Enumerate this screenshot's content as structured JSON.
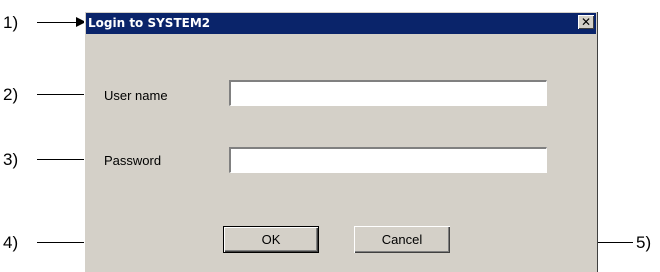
{
  "callouts": {
    "c1": "1)",
    "c2": "2)",
    "c3": "3)",
    "c4": "4)",
    "c5": "5)"
  },
  "dialog": {
    "title": "Login to SYSTEM2",
    "close_icon": "close-icon",
    "close_glyph": "✕",
    "username_label": "User name",
    "username_value": "",
    "password_label": "Password",
    "password_value": "",
    "ok_label": "OK",
    "cancel_label": "Cancel"
  },
  "colors": {
    "titlebar": "#0a246a",
    "dialog_face": "#d4d0c8"
  }
}
